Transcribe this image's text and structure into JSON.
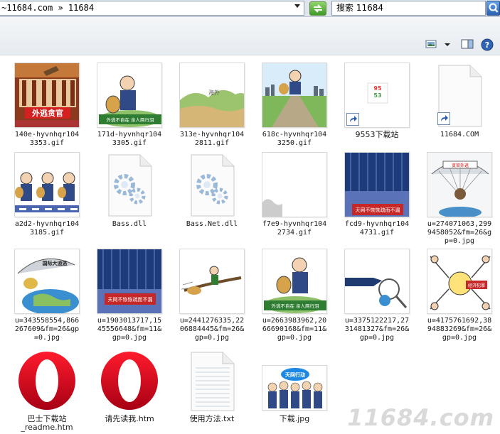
{
  "address": {
    "path": "~11684.com » 11684"
  },
  "search": {
    "text": "搜索 11684"
  },
  "files": [
    {
      "label": "140e-hyvnhqr104\n3353.gif",
      "icon": "gif-thumbnail"
    },
    {
      "label": "171d-hyvnhqr104\n3305.gif",
      "icon": "gif-thumbnail"
    },
    {
      "label": "313e-hyvnhqr104\n2811.gif",
      "icon": "gif-thumbnail"
    },
    {
      "label": "618c-hyvnhqr104\n3250.gif",
      "icon": "gif-thumbnail"
    },
    {
      "label": "9553下载站",
      "icon": "url-shortcut-icon"
    },
    {
      "label": "11684.COM",
      "icon": "blank-shortcut-icon"
    },
    {
      "label": "a2d2-hyvnhqr104\n3185.gif",
      "icon": "gif-thumbnail"
    },
    {
      "label": "Bass.dll",
      "icon": "dll-gear-icon"
    },
    {
      "label": "Bass.Net.dll",
      "icon": "dll-gear-icon"
    },
    {
      "label": "f7e9-hyvnhqr104\n2734.gif",
      "icon": "gif-thumbnail"
    },
    {
      "label": "fcd9-hyvnhqr104\n4731.gif",
      "icon": "gif-thumbnail"
    },
    {
      "label": "u=274071063,299\n9458052&fm=26&g\np=0.jpg",
      "icon": "jpg-thumbnail"
    },
    {
      "label": "u=343558554,866\n267609&fm=26&gp\n=0.jpg",
      "icon": "jpg-thumbnail"
    },
    {
      "label": "u=1903013717,15\n45556648&fm=11&\ngp=0.jpg",
      "icon": "jpg-thumbnail"
    },
    {
      "label": "u=2441276335,22\n06884445&fm=26&\ngp=0.jpg",
      "icon": "jpg-thumbnail"
    },
    {
      "label": "u=2663983962,20\n66690168&fm=11&\ngp=0.jpg",
      "icon": "jpg-thumbnail"
    },
    {
      "label": "u=3375122217,27\n31481327&fm=26&\ngp=0.jpg",
      "icon": "jpg-thumbnail"
    },
    {
      "label": "u=4175761692,38\n94883269&fm=26&\ngp=0.jpg",
      "icon": "jpg-thumbnail"
    },
    {
      "label": "巴士下载站\n_readme.htm",
      "icon": "opera-icon"
    },
    {
      "label": "请先读我.htm",
      "icon": "opera-icon"
    },
    {
      "label": "使用方法.txt",
      "icon": "txt-icon"
    },
    {
      "label": "下载.jpg",
      "icon": "jpg-thumbnail"
    }
  ],
  "thumb_text": {
    "f0": "外逃贪官",
    "f1": "外逃不自在  亲人两行泪",
    "f2": "海外",
    "f10": "天网不恢恢疏而不漏",
    "f11": "贪官外逃",
    "f12": "国际大追逃",
    "f13": "天网不恢恢疏而不漏",
    "f15": "外逃不自在  亲人两行泪",
    "f17": "经济犯罪",
    "f21": "天网行动"
  },
  "watermark": {
    "text": "11684.com"
  },
  "colors": {
    "accent": "#3f9a2a",
    "opera_red": "#e2121b",
    "link_blue": "#2a5fb0"
  }
}
